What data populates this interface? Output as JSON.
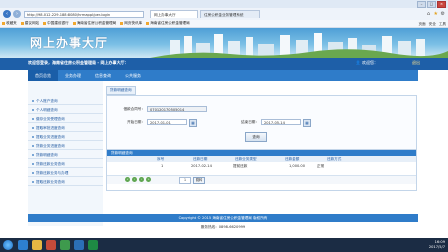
{
  "browser": {
    "url": "http://98.012.229.188:8080/hrmappl/per-login",
    "tabs": [
      {
        "label": "网上办事大厅"
      },
      {
        "label": "住房公积金业务管理系统"
      }
    ],
    "favorites": [
      "收藏夹",
      "建议网站",
      "中国建设银行",
      "海南省住房公积金管理局",
      "网页快讯库",
      "海南省住房公积金管理局"
    ],
    "tools": [
      "页面",
      "安全",
      "工具"
    ]
  },
  "banner": {
    "title": "网上办事大厅"
  },
  "welcome": {
    "message": "欢迎您登录，海南省住房公积金管理局 - 网上办事大厅：",
    "user": "👤 欢迎您：",
    "logout": "退出"
  },
  "menu": [
    "首页总览",
    "业务办理",
    "信息查询",
    "公共服务"
  ],
  "sidebar": [
    "个人账户查询",
    "个人明细查询",
    "缴存业务受理查询",
    "提取审批进度查询",
    "提取业务进度查询",
    "贷款业务进度查询",
    "贷款明细查询",
    "贷款还款业务查询",
    "贷款还款业务与办理",
    "提取还款业务查询"
  ],
  "crumb": "贷款明细查询",
  "form": {
    "account_label": "借款合同号：",
    "account_value": "070120170505014",
    "start_label": "开始日期：",
    "start_value": "2017-01-01",
    "end_label": "结束日期：",
    "end_value": "2017-05-14",
    "query_button": "查询"
  },
  "results": {
    "title": "贷款明细查询",
    "headers": [
      "序号",
      "还款日期",
      "还款业务类型",
      "还款金额",
      "还款方式"
    ],
    "rows": [
      [
        "1",
        "2017-02-14",
        "提前还款",
        "1,000.00",
        "正常"
      ]
    ],
    "pager_go": "跳转",
    "pager_page": "1"
  },
  "footer": {
    "copyright": "Copyright © 2015 海南省住房公积金管理局 版权所有",
    "hotline": "服务热线：0898-6620999"
  },
  "clock": {
    "time": "16:09",
    "date": "2017/5/7"
  }
}
